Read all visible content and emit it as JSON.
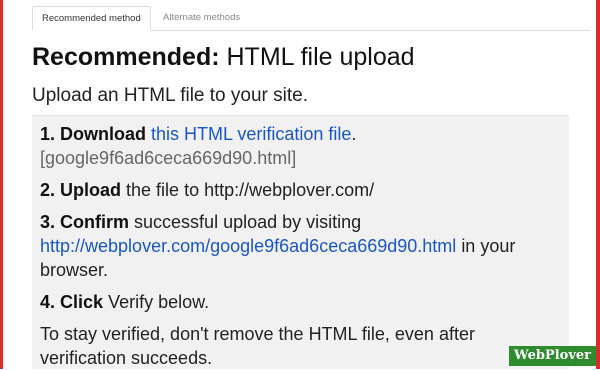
{
  "tabs": {
    "recommended": "Recommended method",
    "alternate": "Alternate methods"
  },
  "heading": {
    "bold": "Recommended:",
    "rest": "HTML file upload"
  },
  "subtitle": "Upload an HTML file to your site.",
  "steps": {
    "s1_bold": "1. Download",
    "s1_link": "this HTML verification file",
    "s1_after": ".",
    "s1_filename": "[google9f6ad6ceca669d90.html]",
    "s2_bold": "2. Upload",
    "s2_text": "the file to http://webplover.com/",
    "s3_bold": "3. Confirm",
    "s3_text": "successful upload by visiting",
    "s3_link": "http://webplover.com/google9f6ad6ceca669d90.html",
    "s3_after": "in your browser.",
    "s4_bold": "4. Click",
    "s4_text": "Verify below.",
    "note": "To stay verified, don't remove the HTML file, even after verification succeeds."
  },
  "watermark": "WebPlover",
  "colors": {
    "frame": "#d92d2d",
    "link": "#1a56c8",
    "badge": "#2e8b2e"
  }
}
